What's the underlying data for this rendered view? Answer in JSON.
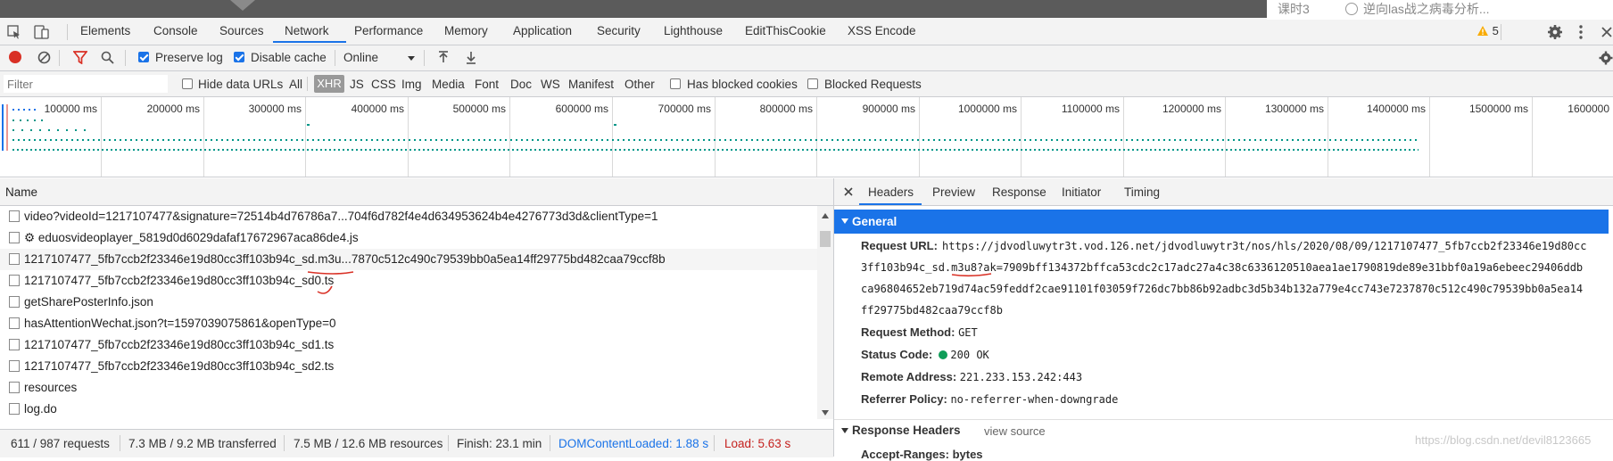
{
  "page_strip": {
    "right_text_1": "课时3",
    "right_text_2": "逆向las战之病毒分析..."
  },
  "tabs": [
    "Elements",
    "Console",
    "Sources",
    "Network",
    "Performance",
    "Memory",
    "Application",
    "Security",
    "Lighthouse",
    "EditThisCookie",
    "XSS Encode"
  ],
  "active_tab": "Network",
  "warnings": {
    "count": "5"
  },
  "toolbar": {
    "preserve_log": "Preserve log",
    "disable_cache": "Disable cache",
    "throttle": "Online"
  },
  "filterbar": {
    "placeholder": "Filter",
    "hide_data_urls": "Hide data URLs",
    "types": [
      "All",
      "XHR",
      "JS",
      "CSS",
      "Img",
      "Media",
      "Font",
      "Doc",
      "WS",
      "Manifest",
      "Other"
    ],
    "active_type": "XHR",
    "has_blocked_cookies": "Has blocked cookies",
    "blocked_requests": "Blocked Requests"
  },
  "timeline": {
    "ticks": [
      "100000 ms",
      "200000 ms",
      "300000 ms",
      "400000 ms",
      "500000 ms",
      "600000 ms",
      "700000 ms",
      "800000 ms",
      "900000 ms",
      "1000000 ms",
      "1100000 ms",
      "1200000 ms",
      "1300000 ms",
      "1400000 ms",
      "1500000 ms",
      "1600000"
    ]
  },
  "requests": {
    "header": "Name",
    "rows": [
      "video?videoId=1217107477&signature=72514b4d76786a7...704f6d782f4e4d634953624b4e4276773d3d&clientType=1",
      "⚙ eduosvideoplayer_5819d0d6029dafaf17672967aca86de4.js",
      "1217107477_5fb7ccb2f23346e19d80cc3ff103b94c_sd.m3u...7870c512c490c79539bb0a5ea14ff29775bd482caa79ccf8b",
      "1217107477_5fb7ccb2f23346e19d80cc3ff103b94c_sd0.ts",
      "getSharePosterInfo.json",
      "hasAttentionWechat.json?t=1597039075861&openType=0",
      "1217107477_5fb7ccb2f23346e19d80cc3ff103b94c_sd1.ts",
      "1217107477_5fb7ccb2f23346e19d80cc3ff103b94c_sd2.ts",
      "resources",
      "log.do"
    ]
  },
  "status": {
    "requests": "611 / 987 requests",
    "transferred": "7.3 MB / 9.2 MB transferred",
    "resources": "7.5 MB / 12.6 MB resources",
    "finish": "Finish: 23.1 min",
    "dom": "DOMContentLoaded: 1.88 s",
    "load": "Load: 5.63 s"
  },
  "detail": {
    "tabs": [
      "Headers",
      "Preview",
      "Response",
      "Initiator",
      "Timing"
    ],
    "active_tab": "Headers",
    "general_title": "General",
    "request_url_label": "Request URL:",
    "request_url_lines": [
      "https://jdvodluwytr3t.vod.126.net/jdvodluwytr3t/nos/hls/2020/08/09/1217107477_5fb7ccb2f23346e19d80cc",
      "3ff103b94c_sd.m3u8?ak=7909bff134372bffca53cdc2c17adc27a4c38c6336120510aea1ae1790819de89e31bbf0a19a6ebeec29406ddb",
      "ca96804652eb719d74ac59feddf2cae91101f03059f726dc7bb86b92adbc3d5b34b132a779e4cc743e7237870c512c490c79539bb0a5ea14",
      "ff29775bd482caa79ccf8b"
    ],
    "request_method_label": "Request Method:",
    "request_method": "GET",
    "status_code_label": "Status Code:",
    "status_code": "200 OK",
    "remote_address_label": "Remote Address:",
    "remote_address": "221.233.153.242:443",
    "referrer_policy_label": "Referrer Policy:",
    "referrer_policy": "no-referrer-when-downgrade",
    "response_headers_title": "Response Headers",
    "view_source": "view source",
    "next_header_partial": "Accept-Ranges: bytes"
  },
  "watermark": "https://blog.csdn.net/devil8123665",
  "colors": {
    "accent": "#1a73e8",
    "record_red": "#d93025",
    "status_green": "#0f9d58",
    "load_red": "#c5221f",
    "dom_blue": "#1a73e8"
  }
}
